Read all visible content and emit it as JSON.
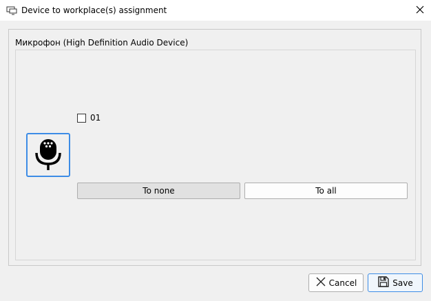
{
  "window": {
    "title": "Device to workplace(s) assignment",
    "icon": "monitor-icon",
    "close_icon": "close-icon"
  },
  "group": {
    "title": "Микрофон (High Definition Audio Device)",
    "device_icon": "microphone-icon"
  },
  "workplaces": [
    {
      "label": "01",
      "checked": false
    }
  ],
  "actions": {
    "to_none": "To none",
    "to_all": "To all"
  },
  "footer": {
    "cancel": "Cancel",
    "cancel_icon": "x-icon",
    "save": "Save",
    "save_icon": "floppy-disk-icon"
  },
  "colors": {
    "accent": "#3c8ce6",
    "background": "#f0f0f0",
    "titlebar": "#ffffff"
  }
}
